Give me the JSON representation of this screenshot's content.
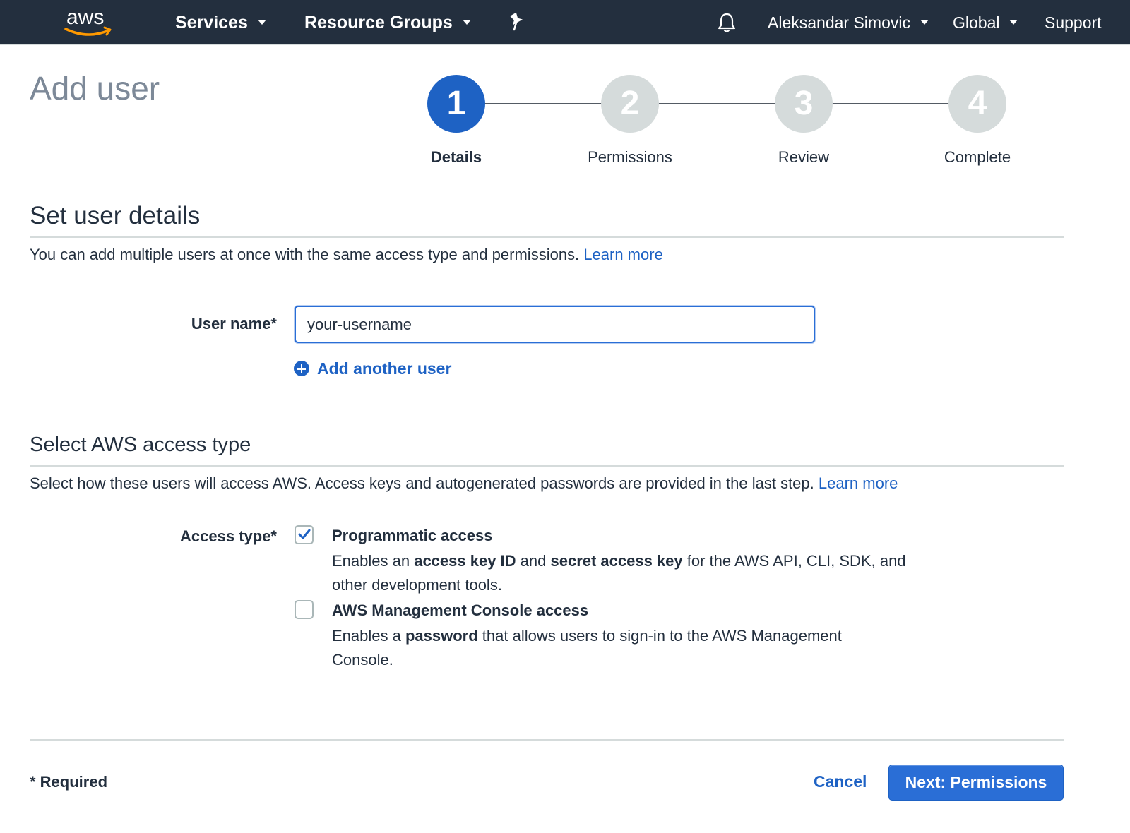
{
  "nav": {
    "logo_text": "aws",
    "services": "Services",
    "resource_groups": "Resource Groups",
    "user": "Aleksandar Simovic",
    "region": "Global",
    "support": "Support"
  },
  "page": {
    "title": "Add user"
  },
  "wizard": {
    "steps": [
      {
        "number": "1",
        "label": "Details",
        "active": true
      },
      {
        "number": "2",
        "label": "Permissions",
        "active": false
      },
      {
        "number": "3",
        "label": "Review",
        "active": false
      },
      {
        "number": "4",
        "label": "Complete",
        "active": false
      }
    ]
  },
  "user_details": {
    "title": "Set user details",
    "description": "You can add multiple users at once with the same access type and permissions.",
    "learn_more": "Learn more",
    "username_label": "User name*",
    "username_value": "your-username",
    "add_another": "Add another user"
  },
  "access": {
    "title": "Select AWS access type",
    "description": "Select how these users will access AWS. Access keys and autogenerated passwords are provided in the last step.",
    "learn_more": "Learn more",
    "label": "Access type*",
    "programmatic": {
      "title": "Programmatic access",
      "checked": true,
      "desc_1": "Enables an ",
      "desc_b1": "access key ID",
      "desc_2": " and ",
      "desc_b2": "secret access key",
      "desc_3": " for the AWS API, CLI, SDK, and other development tools."
    },
    "console": {
      "title": "AWS Management Console access",
      "checked": false,
      "desc_1": "Enables a ",
      "desc_b1": "password",
      "desc_2": " that allows users to sign-in to the AWS Management Console."
    }
  },
  "footer": {
    "required": "* Required",
    "cancel": "Cancel",
    "next": "Next: Permissions"
  },
  "colors": {
    "nav_bg": "#232f3e",
    "accent": "#1e62c4",
    "inactive_step": "#d5dbdb",
    "logo_smile": "#ff9900"
  }
}
